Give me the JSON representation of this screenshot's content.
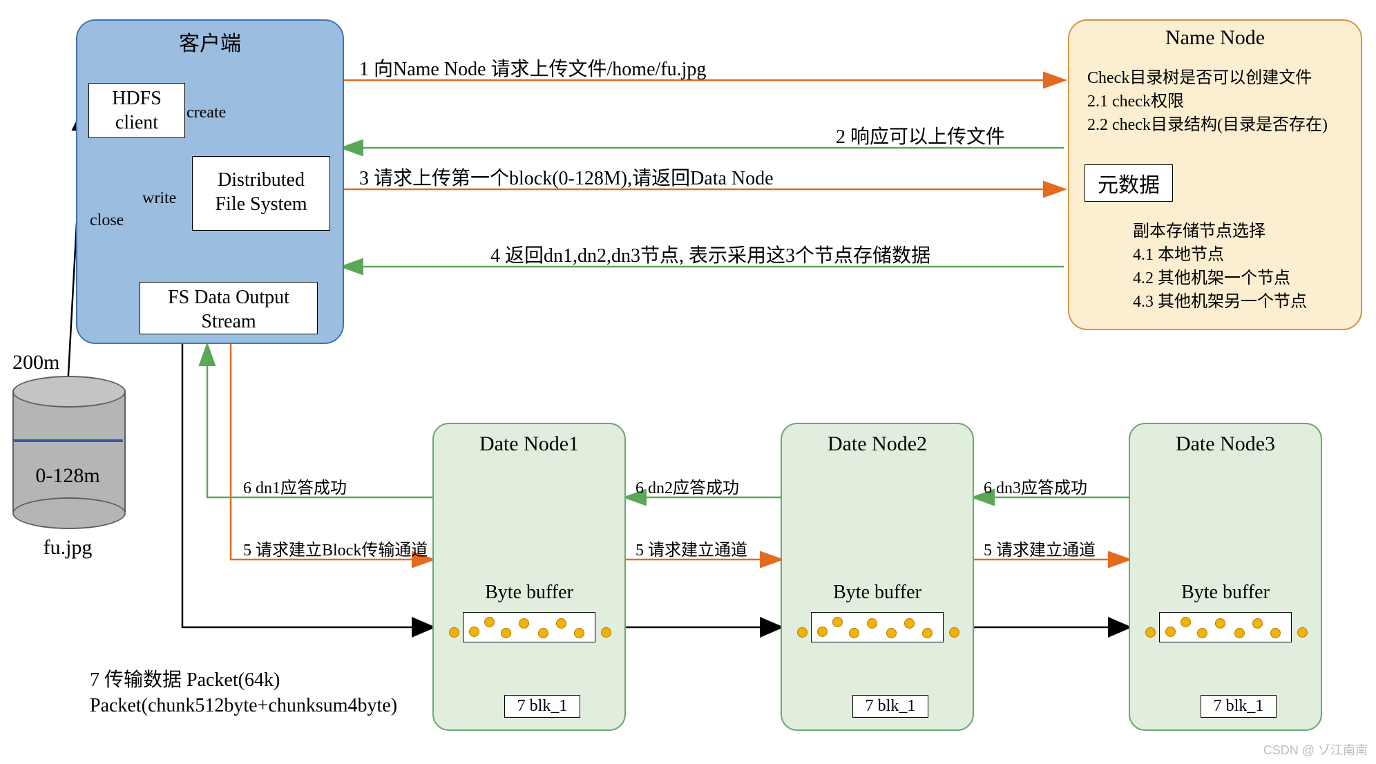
{
  "client": {
    "title": "客户端",
    "hdfs_client": "HDFS\nclient",
    "dfs": "Distributed\nFile System",
    "stream": "FS Data Output\nStream",
    "create": "create",
    "write": "write",
    "close": "close"
  },
  "namenode": {
    "title": "Name Node",
    "check_main": "Check目录树是否可以创建文件",
    "check_1": "2.1 check权限",
    "check_2": "2.2 check目录结构(目录是否存在)",
    "meta": "元数据",
    "replica_title": "副本存储节点选择",
    "replica_1": "4.1 本地节点",
    "replica_2": "4.2 其他机架一个节点",
    "replica_3": "4.3 其他机架另一个节点"
  },
  "steps": {
    "s1": "1 向Name Node 请求上传文件/home/fu.jpg",
    "s2": "2 响应可以上传文件",
    "s3": "3 请求上传第一个block(0-128M),请返回Data Node",
    "s4": "4 返回dn1,dn2,dn3节点, 表示采用这3个节点存储数据",
    "s5_client": "5 请求建立Block传输通道",
    "s5_dn": "5 请求建立通道",
    "s6_1": "6 dn1应答成功",
    "s6_2": "6 dn2应答成功",
    "s6_3": "6 dn3应答成功",
    "s7_title": "7 传输数据  Packet(64k)",
    "s7_sub": "Packet(chunk512byte+chunksum4byte)"
  },
  "dn": {
    "title1": "Date Node1",
    "title2": "Date Node2",
    "title3": "Date Node3",
    "buffer": "Byte buffer",
    "blk": "7 blk_1"
  },
  "file": {
    "size": "200m",
    "range": "0-128m",
    "name": "fu.jpg"
  },
  "watermark": "CSDN @ ゾ江南南"
}
